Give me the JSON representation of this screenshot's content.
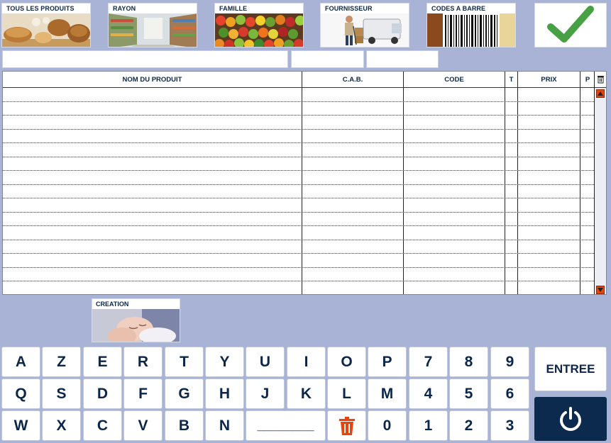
{
  "tiles": {
    "all": "TOUS LES PRODUITS",
    "rayon": "RAYON",
    "famille": "FAMILLE",
    "fournisseur": "FOURNISSEUR",
    "codes": "CODES A BARRE"
  },
  "table": {
    "headers": [
      "NOM DU PRODUIT",
      "C.A.B.",
      "CODE",
      "T",
      "PRIX",
      "P"
    ],
    "rows": 15
  },
  "creation": "CREATION",
  "keyboard": {
    "row1": [
      "A",
      "Z",
      "E",
      "R",
      "T",
      "Y",
      "U",
      "I",
      "O",
      "P",
      "7",
      "8",
      "9"
    ],
    "row2": [
      "Q",
      "S",
      "D",
      "F",
      "G",
      "H",
      "J",
      "K",
      "L",
      "M",
      "4",
      "5",
      "6"
    ],
    "row3": [
      "W",
      "X",
      "C",
      "V",
      "B",
      "N"
    ],
    "space_label": "________",
    "row3_digits": [
      "0",
      "1",
      "2",
      "3"
    ],
    "enter": "ENTREE"
  },
  "icons": {
    "confirm": "checkmark-icon",
    "power": "power-icon",
    "delete": "trash-icon",
    "column_delete": "trash-icon",
    "scroll_up": "arrow-up-icon",
    "scroll_down": "arrow-down-icon"
  },
  "colors": {
    "background": "#a9b3d6",
    "accent_green": "#47a043",
    "power_button": "#0c2a4d",
    "trash": "#e8430b",
    "text": "#0b2648"
  }
}
